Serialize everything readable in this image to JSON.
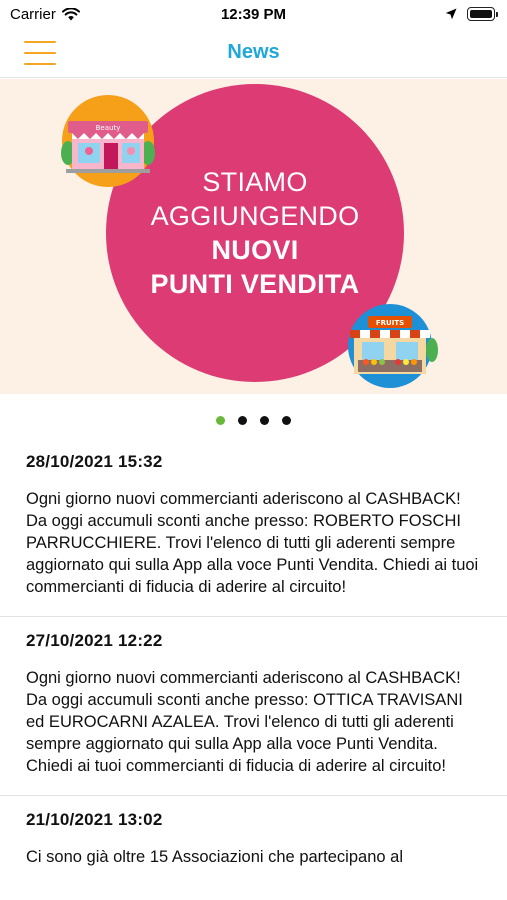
{
  "status_bar": {
    "carrier": "Carrier",
    "time": "12:39 PM"
  },
  "nav": {
    "title": "News",
    "menu_icon": "hamburger-icon",
    "accent_color": "#f5a623",
    "title_color": "#1fa8d8"
  },
  "banner": {
    "line1": "STIAMO",
    "line2": "AGGIUNGENDO",
    "line3": "NUOVI",
    "line4": "PUNTI VENDITA",
    "shop_left_sign": "Beauty",
    "shop_right_sign": "FRUITS",
    "circle_color": "#dc3b73",
    "background_color": "#fdf1e6"
  },
  "carousel": {
    "page_count": 4,
    "active_index": 0
  },
  "news": [
    {
      "date": "28/10/2021 15:32",
      "text": "Ogni giorno nuovi commercianti aderiscono al CASHBACK! Da oggi accumuli sconti anche presso: ROBERTO FOSCHI PARRUCCHIERE. Trovi l'elenco di tutti gli aderenti sempre aggiornato qui sulla App alla voce Punti Vendita. Chiedi ai tuoi commercianti di fiducia di aderire al circuito!"
    },
    {
      "date": "27/10/2021 12:22",
      "text": "Ogni giorno nuovi commercianti aderiscono al CASHBACK! Da oggi accumuli sconti anche presso: OTTICA TRAVISANI ed EUROCARNI AZALEA. Trovi l'elenco di tutti gli aderenti sempre aggiornato qui sulla App alla voce Punti Vendita. Chiedi ai tuoi commercianti di fiducia di aderire al circuito!"
    },
    {
      "date": "21/10/2021 13:02",
      "text": "Ci sono già oltre 15 Associazioni che partecipano al"
    }
  ]
}
